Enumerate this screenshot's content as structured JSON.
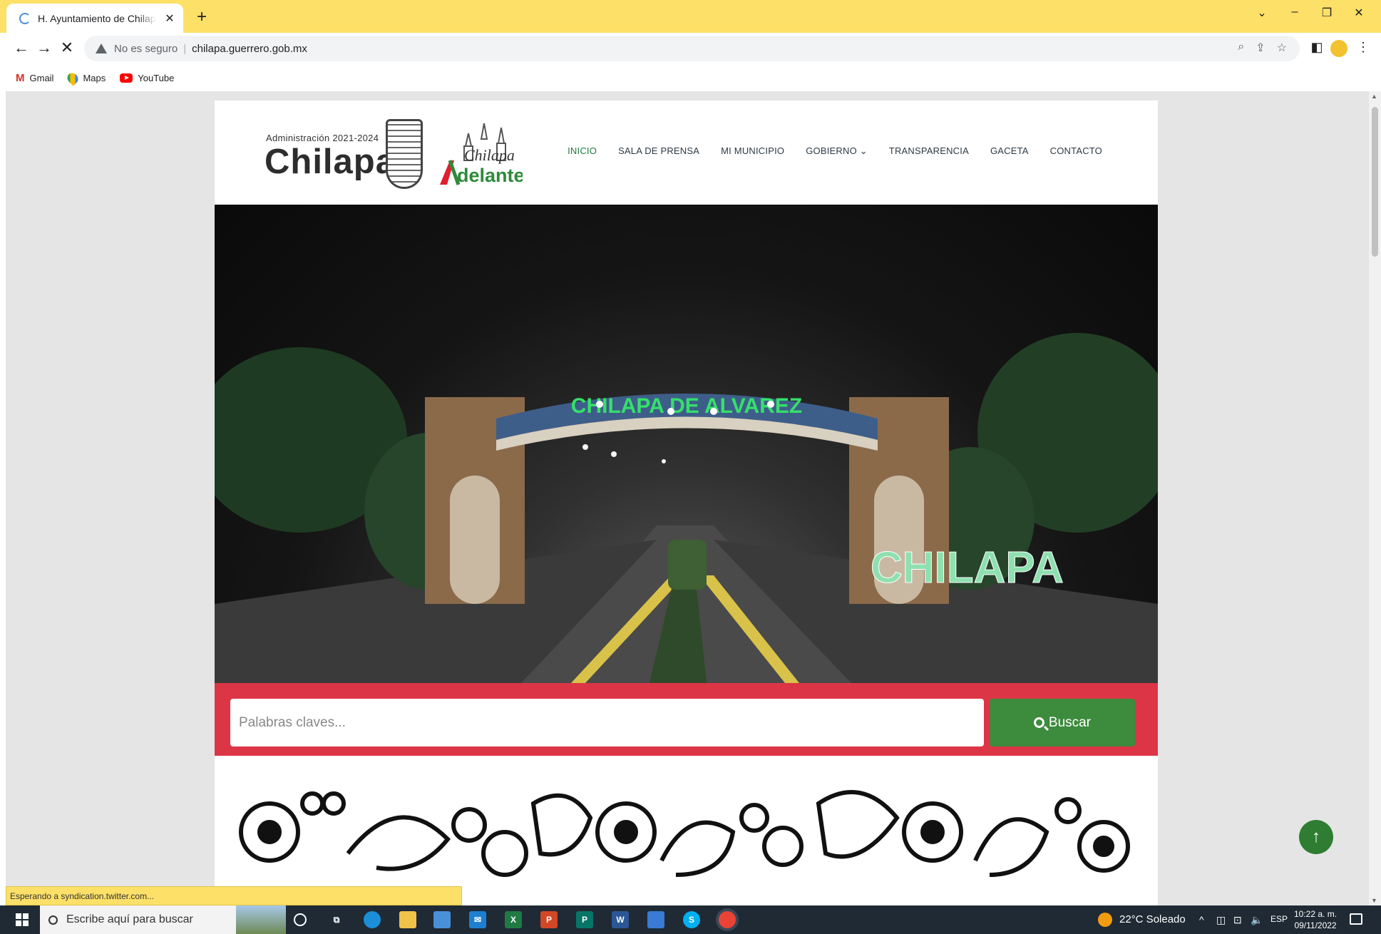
{
  "browser": {
    "tab_title": "H. Ayuntamiento de Chilapa de Álvarez",
    "address_security": "No es seguro",
    "address_url": "chilapa.guerrero.gob.mx",
    "bookmarks": [
      {
        "label": "Gmail"
      },
      {
        "label": "Maps"
      },
      {
        "label": "YouTube"
      }
    ],
    "status_text": "Esperando a syndication.twitter.com..."
  },
  "site": {
    "admin_label": "Administración 2021-2024",
    "logo_name": "Chilapa",
    "adelante_top": "Chilapa",
    "adelante_bottom": "delante",
    "nav": [
      {
        "label": "INICIO",
        "active": true
      },
      {
        "label": "SALA DE PRENSA"
      },
      {
        "label": "MI MUNICIPIO"
      },
      {
        "label": "GOBIERNO ⌄"
      },
      {
        "label": "TRANSPARENCIA"
      },
      {
        "label": "GACETA"
      },
      {
        "label": "CONTACTO"
      }
    ],
    "hero": {
      "arch_text": "CHILAPA DE ALVAREZ",
      "letters_sign": "CHILAPA"
    },
    "search": {
      "placeholder": "Palabras claves...",
      "button_label": "Buscar"
    },
    "to_top_icon": "arrow-up-icon"
  },
  "taskbar": {
    "search_placeholder": "Escribe aquí para buscar",
    "weather": "22°C  Soleado",
    "lang": "ESP",
    "time": "10:22 a. m.",
    "date": "09/11/2022"
  },
  "colors": {
    "tab_bar": "#fde068",
    "search_band": "#dc3545",
    "search_button": "#3d8b3d",
    "nav_active": "#1e7a3c",
    "arch_neon": "#35e06a"
  }
}
